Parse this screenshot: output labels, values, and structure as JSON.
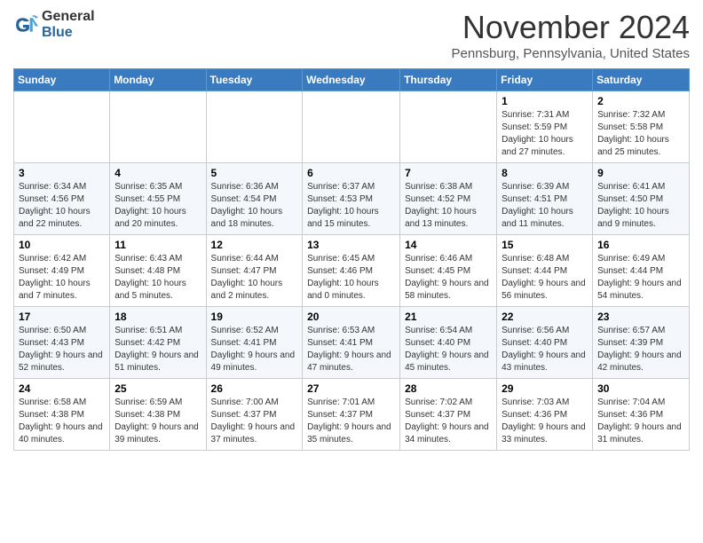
{
  "header": {
    "logo_general": "General",
    "logo_blue": "Blue",
    "month_title": "November 2024",
    "location": "Pennsburg, Pennsylvania, United States"
  },
  "days_of_week": [
    "Sunday",
    "Monday",
    "Tuesday",
    "Wednesday",
    "Thursday",
    "Friday",
    "Saturday"
  ],
  "weeks": [
    [
      {
        "day": "",
        "info": ""
      },
      {
        "day": "",
        "info": ""
      },
      {
        "day": "",
        "info": ""
      },
      {
        "day": "",
        "info": ""
      },
      {
        "day": "",
        "info": ""
      },
      {
        "day": "1",
        "info": "Sunrise: 7:31 AM\nSunset: 5:59 PM\nDaylight: 10 hours and 27 minutes."
      },
      {
        "day": "2",
        "info": "Sunrise: 7:32 AM\nSunset: 5:58 PM\nDaylight: 10 hours and 25 minutes."
      }
    ],
    [
      {
        "day": "3",
        "info": "Sunrise: 6:34 AM\nSunset: 4:56 PM\nDaylight: 10 hours and 22 minutes."
      },
      {
        "day": "4",
        "info": "Sunrise: 6:35 AM\nSunset: 4:55 PM\nDaylight: 10 hours and 20 minutes."
      },
      {
        "day": "5",
        "info": "Sunrise: 6:36 AM\nSunset: 4:54 PM\nDaylight: 10 hours and 18 minutes."
      },
      {
        "day": "6",
        "info": "Sunrise: 6:37 AM\nSunset: 4:53 PM\nDaylight: 10 hours and 15 minutes."
      },
      {
        "day": "7",
        "info": "Sunrise: 6:38 AM\nSunset: 4:52 PM\nDaylight: 10 hours and 13 minutes."
      },
      {
        "day": "8",
        "info": "Sunrise: 6:39 AM\nSunset: 4:51 PM\nDaylight: 10 hours and 11 minutes."
      },
      {
        "day": "9",
        "info": "Sunrise: 6:41 AM\nSunset: 4:50 PM\nDaylight: 10 hours and 9 minutes."
      }
    ],
    [
      {
        "day": "10",
        "info": "Sunrise: 6:42 AM\nSunset: 4:49 PM\nDaylight: 10 hours and 7 minutes."
      },
      {
        "day": "11",
        "info": "Sunrise: 6:43 AM\nSunset: 4:48 PM\nDaylight: 10 hours and 5 minutes."
      },
      {
        "day": "12",
        "info": "Sunrise: 6:44 AM\nSunset: 4:47 PM\nDaylight: 10 hours and 2 minutes."
      },
      {
        "day": "13",
        "info": "Sunrise: 6:45 AM\nSunset: 4:46 PM\nDaylight: 10 hours and 0 minutes."
      },
      {
        "day": "14",
        "info": "Sunrise: 6:46 AM\nSunset: 4:45 PM\nDaylight: 9 hours and 58 minutes."
      },
      {
        "day": "15",
        "info": "Sunrise: 6:48 AM\nSunset: 4:44 PM\nDaylight: 9 hours and 56 minutes."
      },
      {
        "day": "16",
        "info": "Sunrise: 6:49 AM\nSunset: 4:44 PM\nDaylight: 9 hours and 54 minutes."
      }
    ],
    [
      {
        "day": "17",
        "info": "Sunrise: 6:50 AM\nSunset: 4:43 PM\nDaylight: 9 hours and 52 minutes."
      },
      {
        "day": "18",
        "info": "Sunrise: 6:51 AM\nSunset: 4:42 PM\nDaylight: 9 hours and 51 minutes."
      },
      {
        "day": "19",
        "info": "Sunrise: 6:52 AM\nSunset: 4:41 PM\nDaylight: 9 hours and 49 minutes."
      },
      {
        "day": "20",
        "info": "Sunrise: 6:53 AM\nSunset: 4:41 PM\nDaylight: 9 hours and 47 minutes."
      },
      {
        "day": "21",
        "info": "Sunrise: 6:54 AM\nSunset: 4:40 PM\nDaylight: 9 hours and 45 minutes."
      },
      {
        "day": "22",
        "info": "Sunrise: 6:56 AM\nSunset: 4:40 PM\nDaylight: 9 hours and 43 minutes."
      },
      {
        "day": "23",
        "info": "Sunrise: 6:57 AM\nSunset: 4:39 PM\nDaylight: 9 hours and 42 minutes."
      }
    ],
    [
      {
        "day": "24",
        "info": "Sunrise: 6:58 AM\nSunset: 4:38 PM\nDaylight: 9 hours and 40 minutes."
      },
      {
        "day": "25",
        "info": "Sunrise: 6:59 AM\nSunset: 4:38 PM\nDaylight: 9 hours and 39 minutes."
      },
      {
        "day": "26",
        "info": "Sunrise: 7:00 AM\nSunset: 4:37 PM\nDaylight: 9 hours and 37 minutes."
      },
      {
        "day": "27",
        "info": "Sunrise: 7:01 AM\nSunset: 4:37 PM\nDaylight: 9 hours and 35 minutes."
      },
      {
        "day": "28",
        "info": "Sunrise: 7:02 AM\nSunset: 4:37 PM\nDaylight: 9 hours and 34 minutes."
      },
      {
        "day": "29",
        "info": "Sunrise: 7:03 AM\nSunset: 4:36 PM\nDaylight: 9 hours and 33 minutes."
      },
      {
        "day": "30",
        "info": "Sunrise: 7:04 AM\nSunset: 4:36 PM\nDaylight: 9 hours and 31 minutes."
      }
    ]
  ]
}
